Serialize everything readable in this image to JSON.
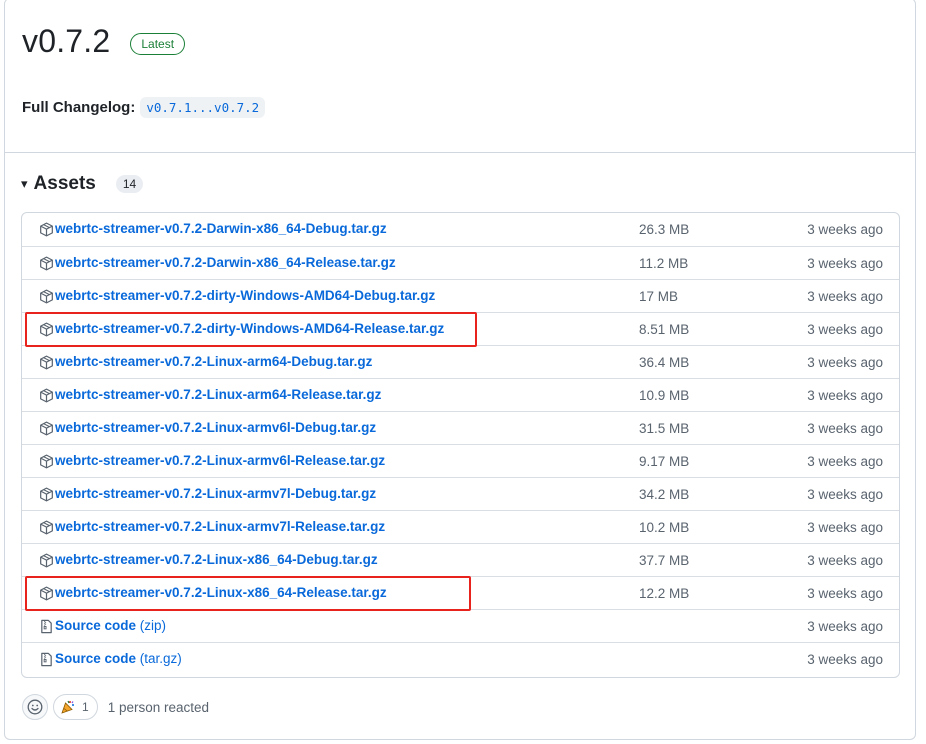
{
  "release": {
    "title": "v0.7.2",
    "badge": "Latest",
    "changelog_label": "Full Changelog:",
    "changelog_link": "v0.7.1...v0.7.2"
  },
  "assets": {
    "caret": "▾",
    "title": "Assets",
    "count": "14",
    "items": [
      {
        "name": "webrtc-streamer-v0.7.2-Darwin-x86_64-Debug.tar.gz",
        "suffix": "",
        "size": "26.3 MB",
        "date": "3 weeks ago",
        "icon": "package-icon"
      },
      {
        "name": "webrtc-streamer-v0.7.2-Darwin-x86_64-Release.tar.gz",
        "suffix": "",
        "size": "11.2 MB",
        "date": "3 weeks ago",
        "icon": "package-icon"
      },
      {
        "name": "webrtc-streamer-v0.7.2-dirty-Windows-AMD64-Debug.tar.gz",
        "suffix": "",
        "size": "17 MB",
        "date": "3 weeks ago",
        "icon": "package-icon"
      },
      {
        "name": "webrtc-streamer-v0.7.2-dirty-Windows-AMD64-Release.tar.gz",
        "suffix": "",
        "size": "8.51 MB",
        "date": "3 weeks ago",
        "icon": "package-icon"
      },
      {
        "name": "webrtc-streamer-v0.7.2-Linux-arm64-Debug.tar.gz",
        "suffix": "",
        "size": "36.4 MB",
        "date": "3 weeks ago",
        "icon": "package-icon"
      },
      {
        "name": "webrtc-streamer-v0.7.2-Linux-arm64-Release.tar.gz",
        "suffix": "",
        "size": "10.9 MB",
        "date": "3 weeks ago",
        "icon": "package-icon"
      },
      {
        "name": "webrtc-streamer-v0.7.2-Linux-armv6l-Debug.tar.gz",
        "suffix": "",
        "size": "31.5 MB",
        "date": "3 weeks ago",
        "icon": "package-icon"
      },
      {
        "name": "webrtc-streamer-v0.7.2-Linux-armv6l-Release.tar.gz",
        "suffix": "",
        "size": "9.17 MB",
        "date": "3 weeks ago",
        "icon": "package-icon"
      },
      {
        "name": "webrtc-streamer-v0.7.2-Linux-armv7l-Debug.tar.gz",
        "suffix": "",
        "size": "34.2 MB",
        "date": "3 weeks ago",
        "icon": "package-icon"
      },
      {
        "name": "webrtc-streamer-v0.7.2-Linux-armv7l-Release.tar.gz",
        "suffix": "",
        "size": "10.2 MB",
        "date": "3 weeks ago",
        "icon": "package-icon"
      },
      {
        "name": "webrtc-streamer-v0.7.2-Linux-x86_64-Debug.tar.gz",
        "suffix": "",
        "size": "37.7 MB",
        "date": "3 weeks ago",
        "icon": "package-icon"
      },
      {
        "name": "webrtc-streamer-v0.7.2-Linux-x86_64-Release.tar.gz",
        "suffix": "",
        "size": "12.2 MB",
        "date": "3 weeks ago",
        "icon": "package-icon"
      },
      {
        "name": "Source code",
        "suffix": " (zip)",
        "size": "",
        "date": "3 weeks ago",
        "icon": "file-zip-icon"
      },
      {
        "name": "Source code",
        "suffix": " (tar.gz)",
        "size": "",
        "date": "3 weeks ago",
        "icon": "file-zip-icon"
      }
    ],
    "highlighted_rows": [
      3,
      11
    ]
  },
  "reactions": {
    "add_icon": "smiley-icon",
    "reaction_emoji_icon": "party-popper-icon",
    "reaction_count": "1",
    "summary": "1 person reacted"
  },
  "colors": {
    "link": "#0969da",
    "latest_badge": "#1a7f37",
    "highlight_box": "#e8231e",
    "muted_text": "#59636e"
  }
}
